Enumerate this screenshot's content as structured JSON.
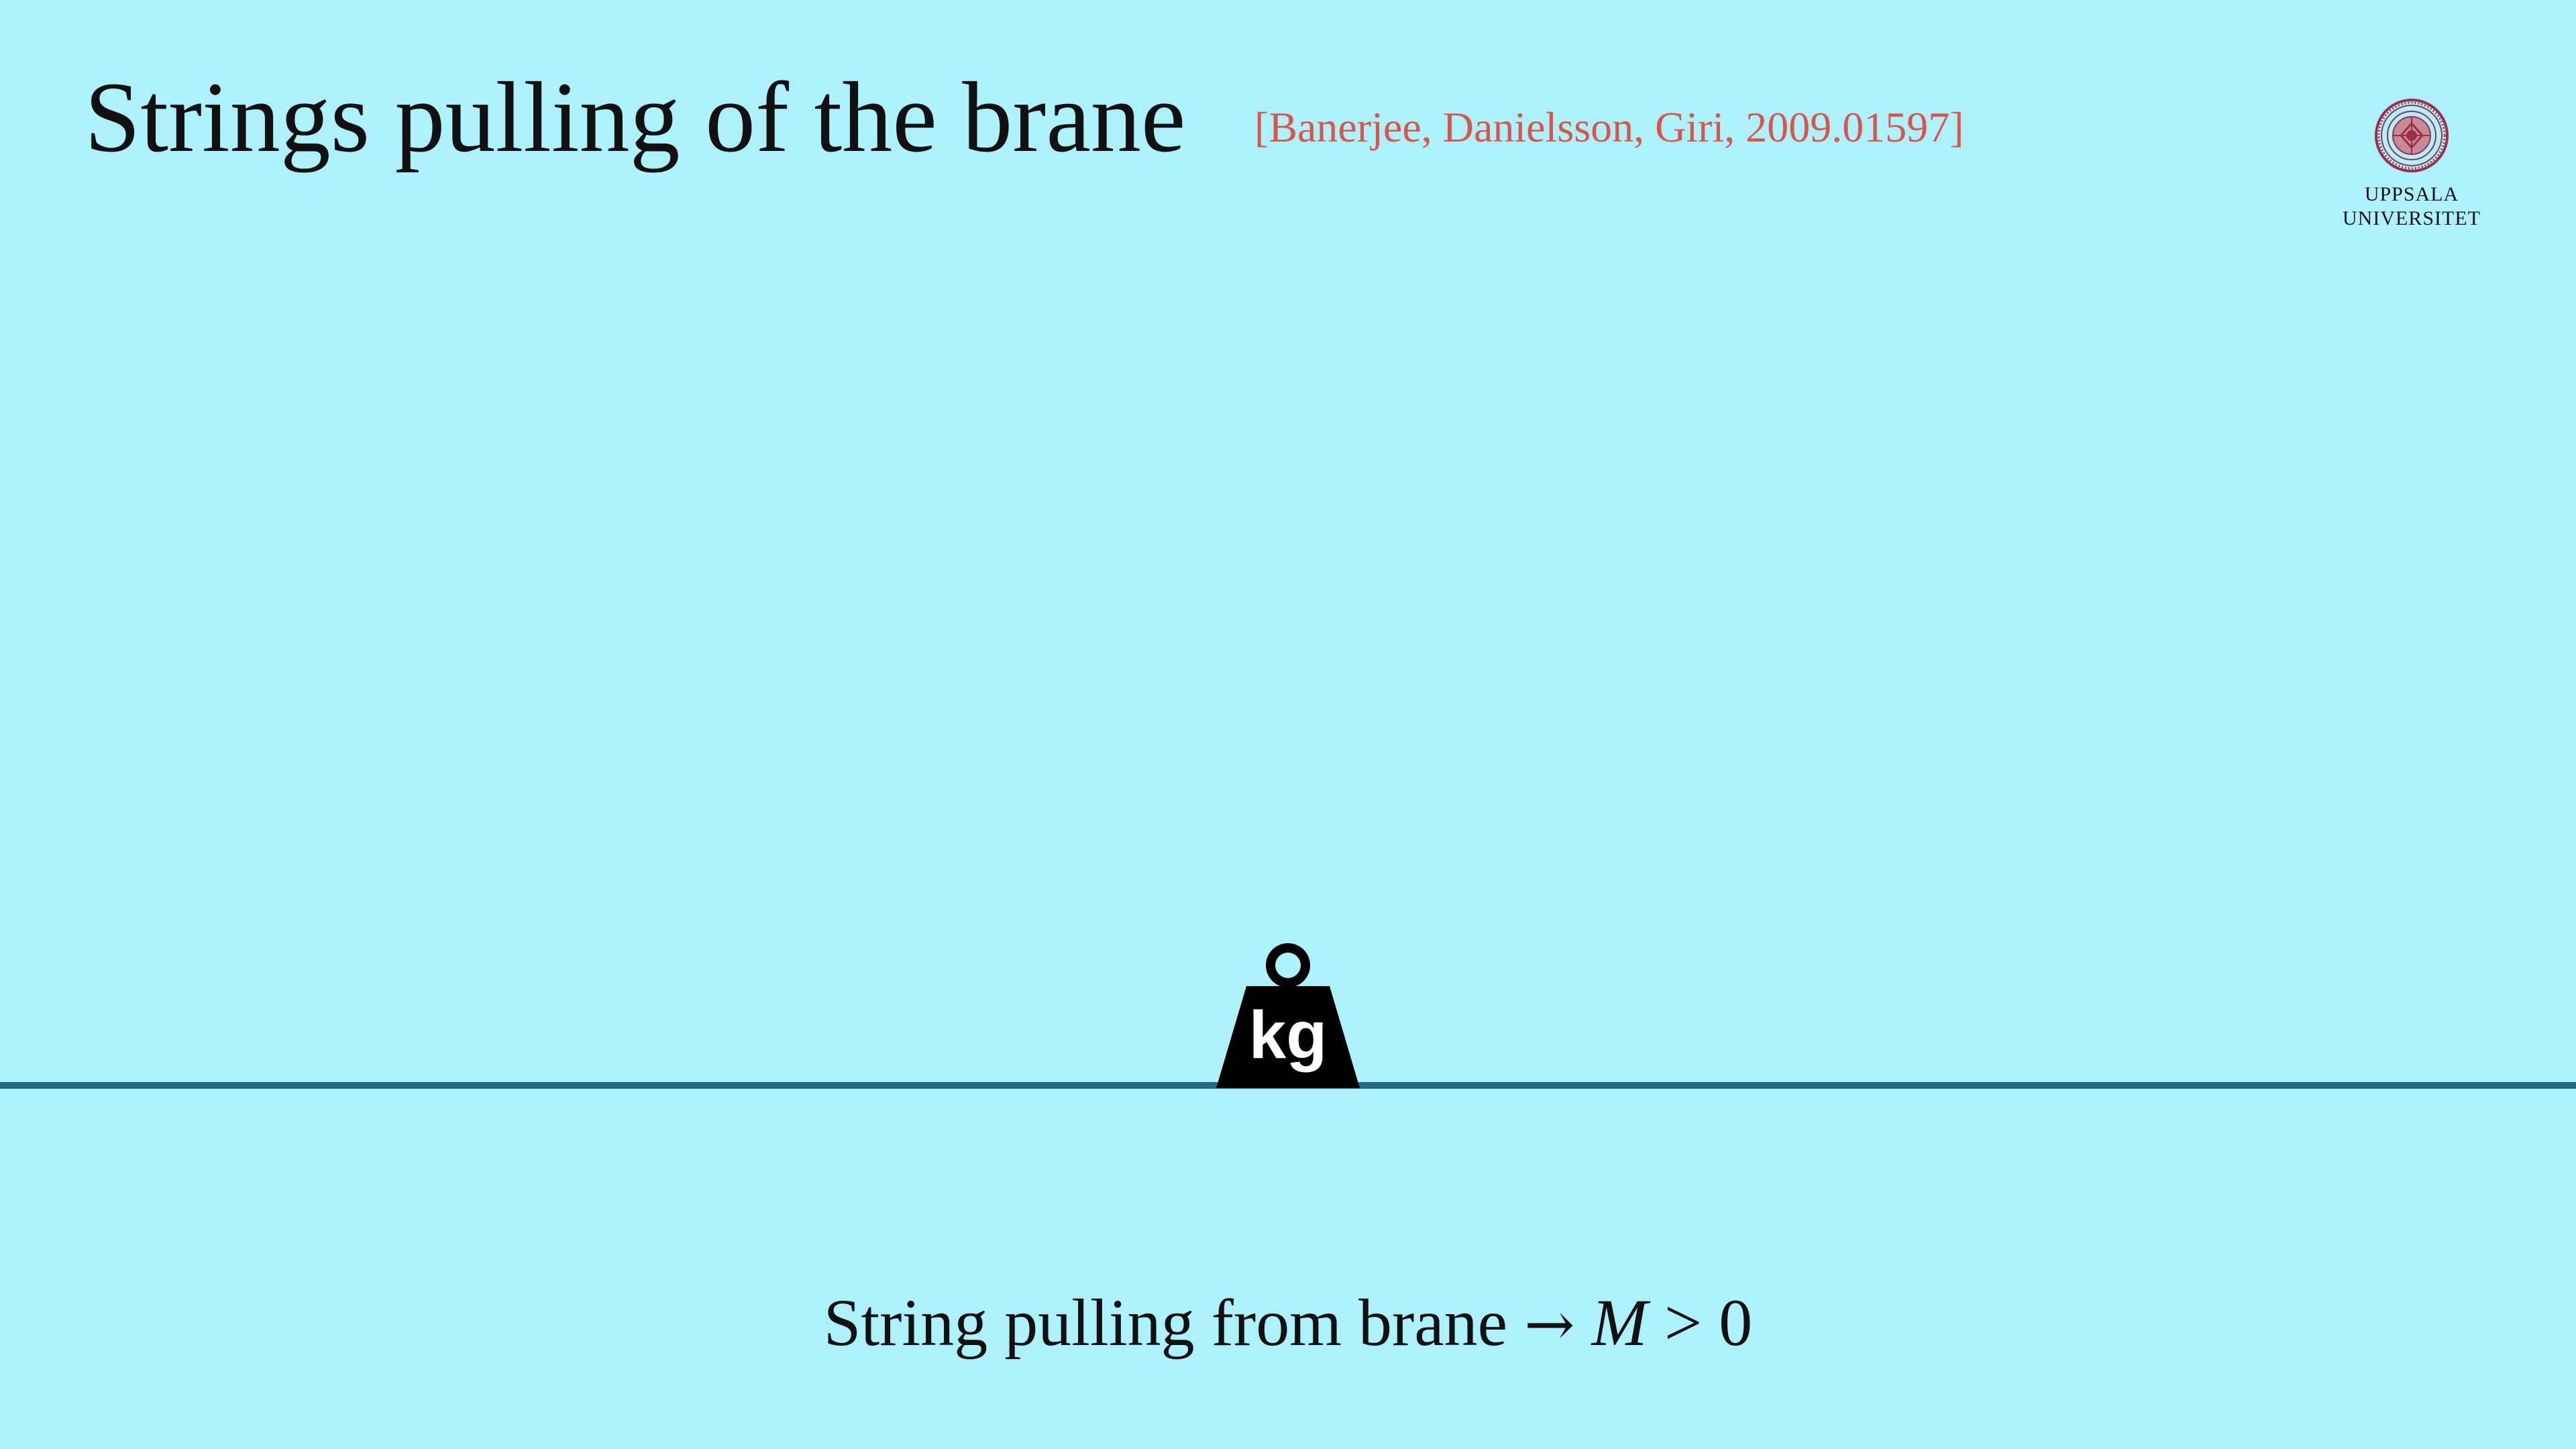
{
  "slide": {
    "title": "Strings pulling of the brane",
    "citation": "[Banerjee, Danielsson, Giri, 2009.01597]",
    "logo": {
      "line1": "UPPSALA",
      "line2": "UNIVERSITET",
      "icon": "university-seal-icon"
    },
    "weight": {
      "label": "kg",
      "icon": "weight-icon"
    },
    "caption": {
      "text": "String pulling from brane",
      "arrow": "→",
      "math": "M",
      "relation": " > 0"
    },
    "colors": {
      "background": "#adf1fd",
      "citation": "#d9574a",
      "brane": "#236b85",
      "seal": "#9b2f46"
    }
  }
}
